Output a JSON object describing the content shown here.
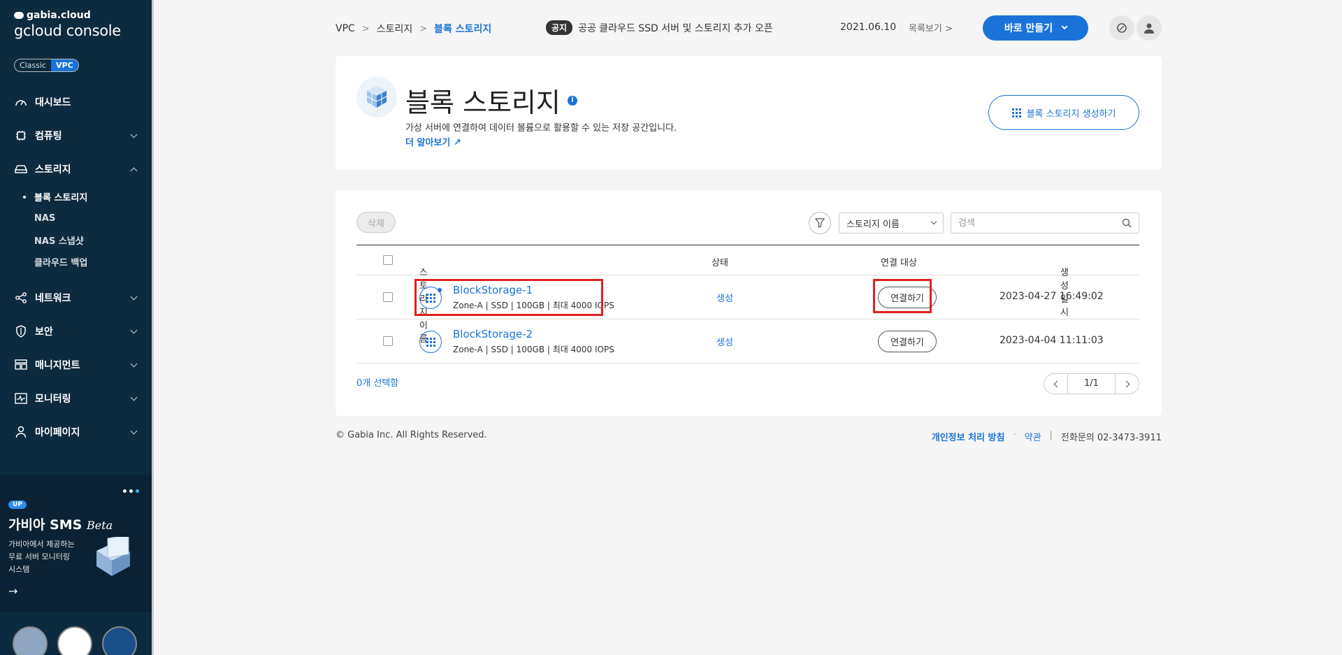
{
  "sidebar": {
    "brand_small": "gabia.cloud",
    "brand_big": "gcloud console",
    "mode": {
      "classic": "Classic",
      "vpc": "VPC"
    },
    "menu": [
      {
        "label": "대시보드",
        "icon": "dashboard-icon"
      },
      {
        "label": "컴퓨팅",
        "icon": "cpu-icon"
      },
      {
        "label": "스토리지",
        "icon": "storage-icon"
      },
      {
        "label": "네트워크",
        "icon": "network-icon"
      },
      {
        "label": "보안",
        "icon": "shield-icon"
      },
      {
        "label": "매니지먼트",
        "icon": "management-icon"
      },
      {
        "label": "모니터링",
        "icon": "monitoring-icon"
      },
      {
        "label": "마이페이지",
        "icon": "user-icon"
      }
    ],
    "storage_sub": [
      "블록 스토리지",
      "NAS",
      "NAS 스냅샷",
      "클라우드 백업"
    ],
    "promo": {
      "badge": "UP",
      "title": "가비아 SMS",
      "title_em": "Beta",
      "desc": [
        "가비아에서 제공하는",
        "무료 서버 모니터링",
        "시스템"
      ],
      "arrow": "→"
    }
  },
  "topbar": {
    "breadcrumb": [
      "VPC",
      "스토리지",
      "블록 스토리지"
    ],
    "notice_tag": "공지",
    "notice_text": "공공 클라우드 SSD 서버 및 스토리지 추가 오픈",
    "notice_date": "2021.06.10",
    "notice_list": "목록보기",
    "create_label": "바로 만들기"
  },
  "header": {
    "title": "블록 스토리지",
    "info": "i",
    "description": "가상 서버에 연결하여 데이터 볼륨으로 활용할 수 있는 저장 공간입니다.",
    "learn_more": "더 알아보기",
    "create_button": "블록 스토리지 생성하기"
  },
  "toolbar": {
    "delete_label": "삭제",
    "filter_select": "스토리지 이름",
    "search_placeholder": "검색"
  },
  "table": {
    "columns": {
      "name": "스토리지 이름",
      "status": "상태",
      "target": "연결 대상",
      "created": "생성일시"
    },
    "rows": [
      {
        "name": "BlockStorage-1",
        "spec": "Zone-A  |  SSD  |  100GB  |  최대 4000 IOPS",
        "status": "생성",
        "connect": "연결하기",
        "created": "2023-04-27 16:49:02"
      },
      {
        "name": "BlockStorage-2",
        "spec": "Zone-A  |  SSD  |  100GB  |  최대 4000 IOPS",
        "status": "생성",
        "connect": "연결하기",
        "created": "2023-04-04 11:11:03"
      }
    ]
  },
  "selected_count": "0개 선택함",
  "pagination": "1/1",
  "footer": {
    "copyright": "© Gabia Inc. All Rights Reserved.",
    "privacy": "개인정보 처리 방침",
    "terms": "약관",
    "phone": "전화문의  02-3473-3911"
  },
  "colors": {
    "accent": "#1a73d9",
    "sidebar": "#0d2b3e",
    "highlight": "#e02020"
  }
}
